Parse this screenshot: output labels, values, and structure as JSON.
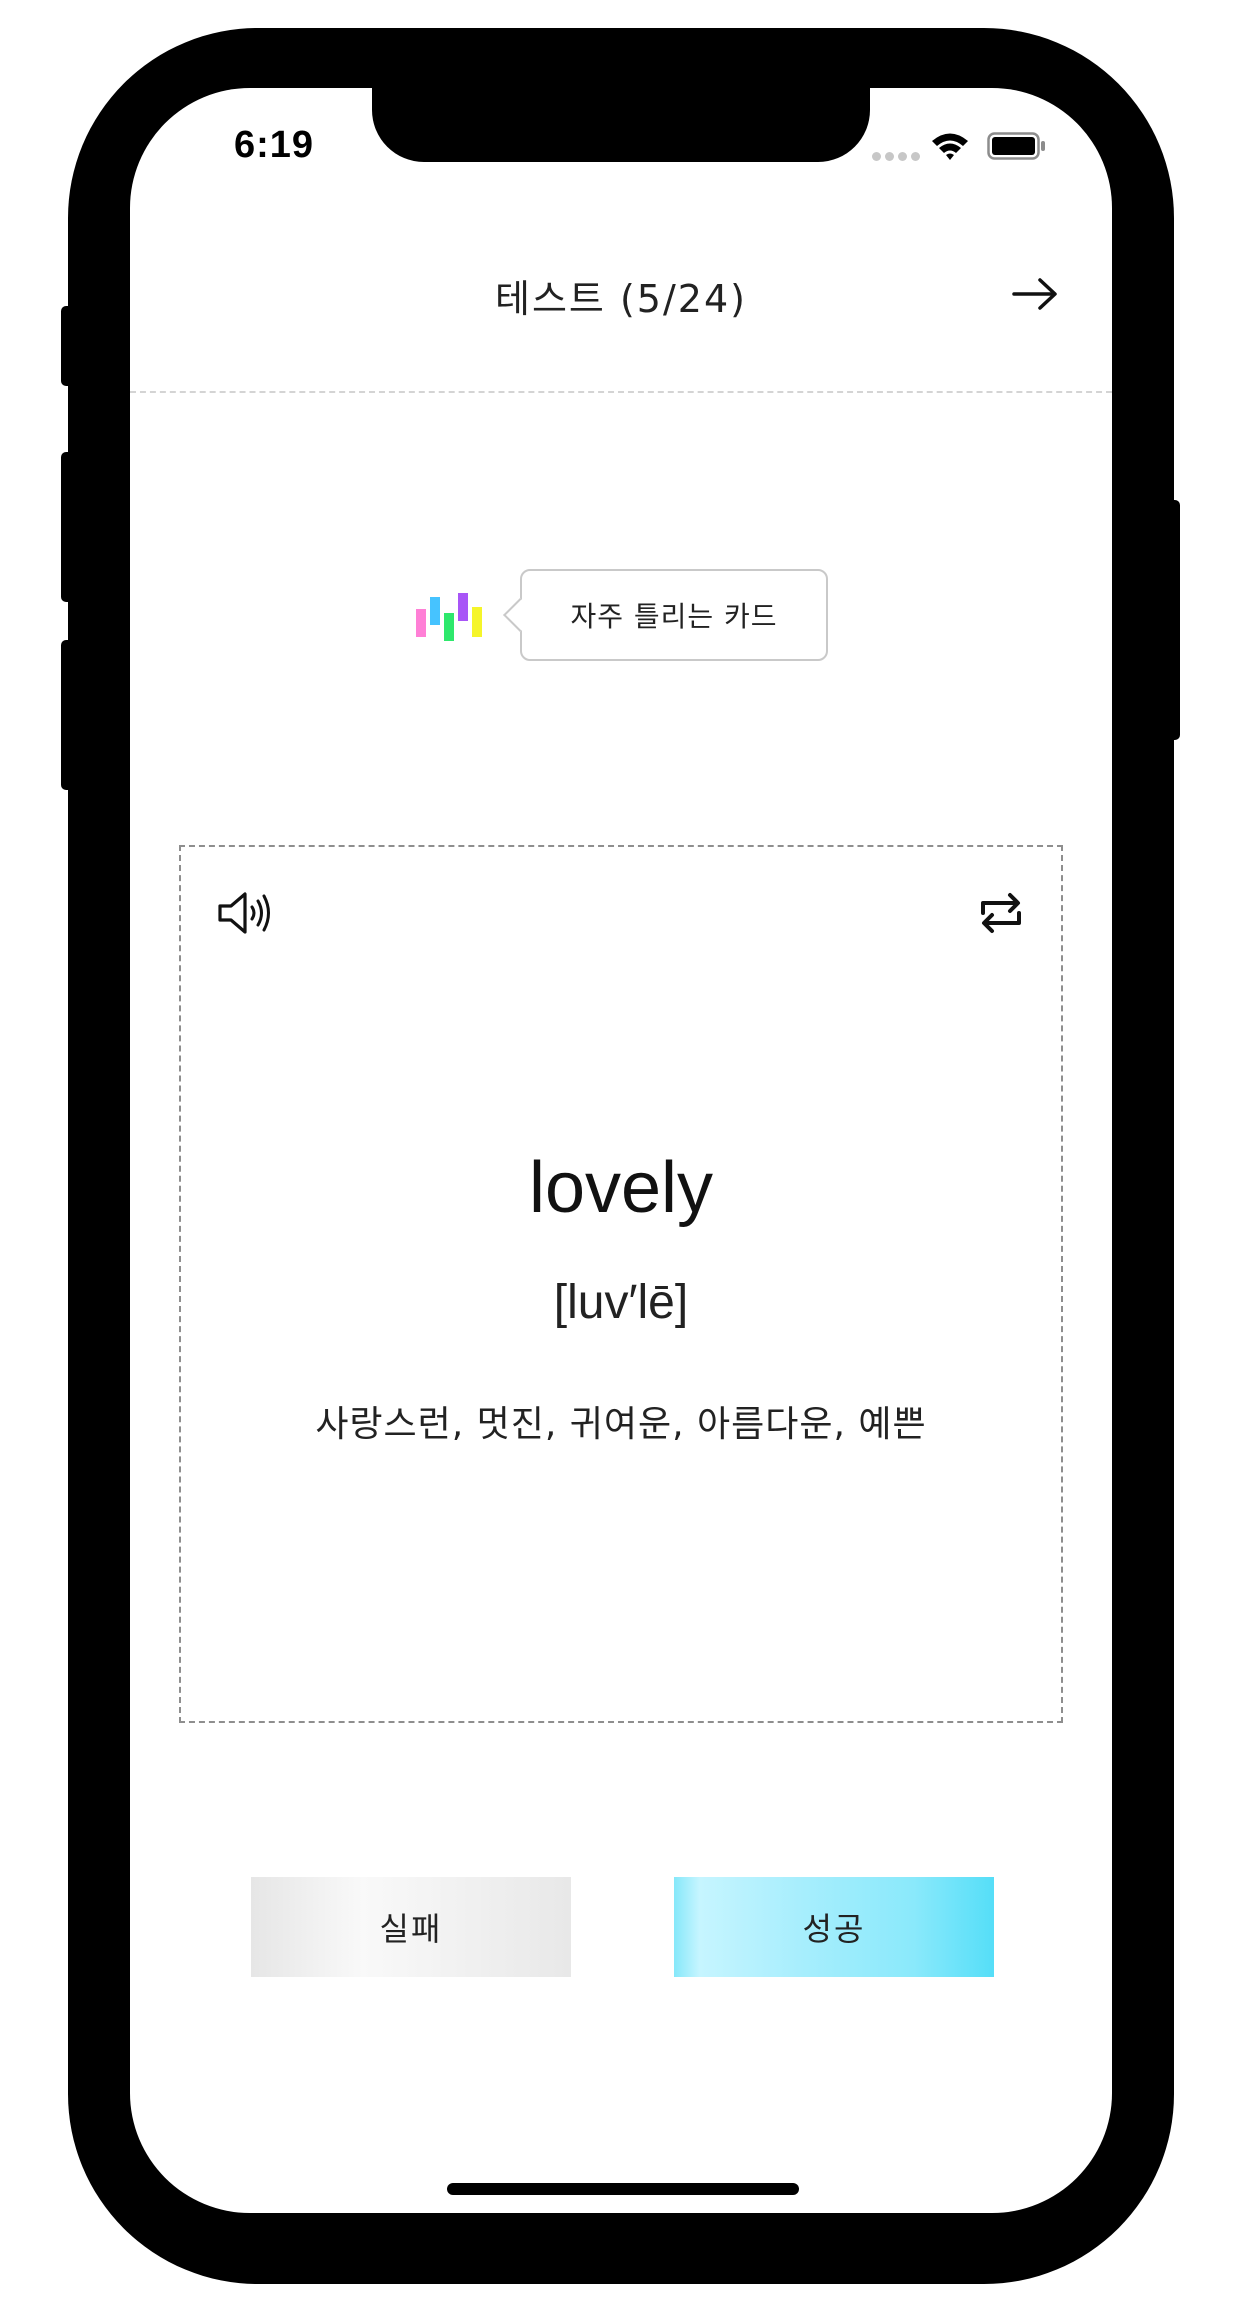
{
  "status_bar": {
    "time": "6:19"
  },
  "header": {
    "title": "테스트 (5/24)",
    "next_icon": "arrow-right-icon"
  },
  "hint": {
    "logo_icon": "bar-logo-icon",
    "logo_colors": [
      "#ff7fd6",
      "#46c3ff",
      "#2ee86c",
      "#a855f7",
      "#f5f52a"
    ],
    "label": "자주 틀리는 카드"
  },
  "card": {
    "speaker_icon": "speaker-icon",
    "flip_icon": "repeat-icon",
    "word": "lovely",
    "pronunciation": "[luv′lē]",
    "meaning": "사랑스런, 멋진, 귀여운, 아름다운, 예쁜"
  },
  "actions": {
    "fail_label": "실패",
    "success_label": "성공",
    "success_color": "#5ad9f7"
  }
}
